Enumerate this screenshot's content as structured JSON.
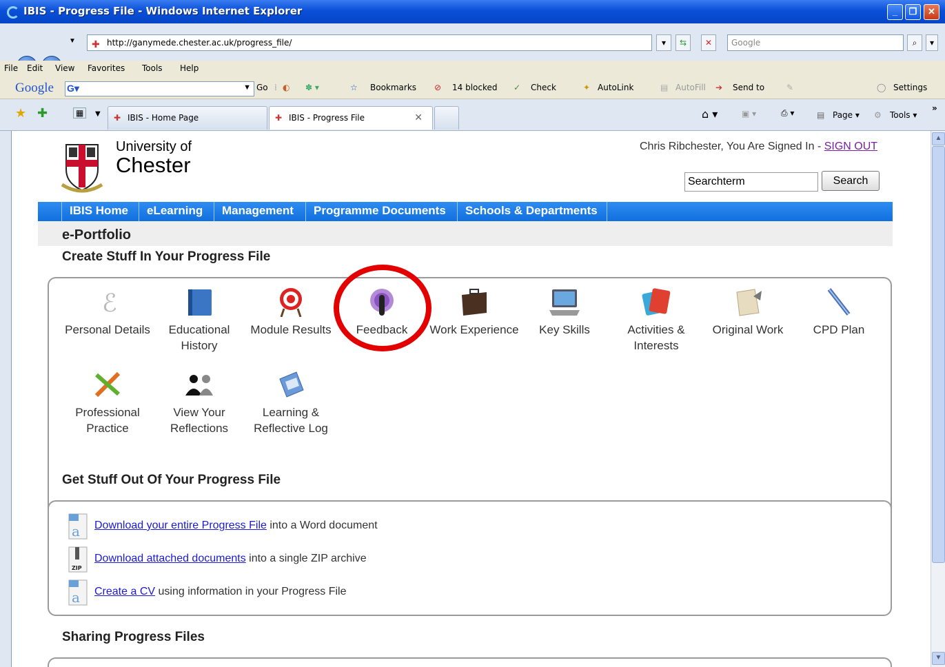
{
  "window": {
    "title": "IBIS - Progress File - Windows Internet Explorer"
  },
  "addressbar": {
    "url": "http://ganymede.chester.ac.uk/progress_file/",
    "search_placeholder": "Google"
  },
  "menubar": [
    "File",
    "Edit",
    "View",
    "Favorites",
    "Tools",
    "Help"
  ],
  "google_toolbar": {
    "logo": "Google",
    "go": "Go",
    "bookmarks": "Bookmarks",
    "blocked": "14 blocked",
    "check": "Check",
    "autolink": "AutoLink",
    "autofill": "AutoFill",
    "sendto": "Send to",
    "settings": "Settings"
  },
  "tabs": [
    {
      "label": "IBIS - Home Page"
    },
    {
      "label": "IBIS - Progress File"
    }
  ],
  "commandbar": {
    "page": "Page",
    "tools": "Tools"
  },
  "header": {
    "uni_line1": "University of",
    "uni_line2": "Chester",
    "signed_in": "Chris Ribchester, You Are Signed In - ",
    "sign_out": "SIGN OUT",
    "search_value": "Searchterm",
    "search_button": "Search"
  },
  "nav": [
    "IBIS Home",
    "eLearning",
    "Management",
    "Programme Documents",
    "Schools & Departments"
  ],
  "page_title": "e-Portfolio",
  "create_section": {
    "title": "Create Stuff In Your Progress File",
    "items": [
      {
        "line1": "Personal Details",
        "line2": "",
        "icon": "personal-details-icon"
      },
      {
        "line1": "Educational",
        "line2": "History",
        "icon": "book-icon"
      },
      {
        "line1": "Module Results",
        "line2": "",
        "icon": "target-icon"
      },
      {
        "line1": "Feedback",
        "line2": "",
        "icon": "microphone-icon"
      },
      {
        "line1": "Work Experience",
        "line2": "",
        "icon": "briefcase-icon"
      },
      {
        "line1": "Key Skills",
        "line2": "",
        "icon": "laptop-icon"
      },
      {
        "line1": "Activities &",
        "line2": "Interests",
        "icon": "tickets-icon"
      },
      {
        "line1": "Original Work",
        "line2": "",
        "icon": "paper-icon"
      },
      {
        "line1": "CPD Plan",
        "line2": "",
        "icon": "pencil-icon"
      },
      {
        "line1": "Professional",
        "line2": "Practice",
        "icon": "tools-icon"
      },
      {
        "line1": "View Your",
        "line2": "Reflections",
        "icon": "people-icon"
      },
      {
        "line1": "Learning &",
        "line2": "Reflective Log",
        "icon": "notebook-icon"
      }
    ]
  },
  "get_section": {
    "title": "Get Stuff Out Of Your Progress File",
    "items": [
      {
        "link": "Download your entire Progress File",
        "rest": " into a Word document",
        "icon": "word-doc-icon"
      },
      {
        "link": "Download attached documents",
        "rest": " into a single ZIP archive",
        "icon": "zip-file-icon"
      },
      {
        "link": "Create a CV",
        "rest": " using information in your Progress File",
        "icon": "word-doc-icon"
      }
    ]
  },
  "share_section": {
    "title": "Sharing Progress Files"
  },
  "colors": {
    "nav_blue": "#1a7ae8",
    "circle_red": "#e30000",
    "link_blue": "#1a1ad8"
  }
}
